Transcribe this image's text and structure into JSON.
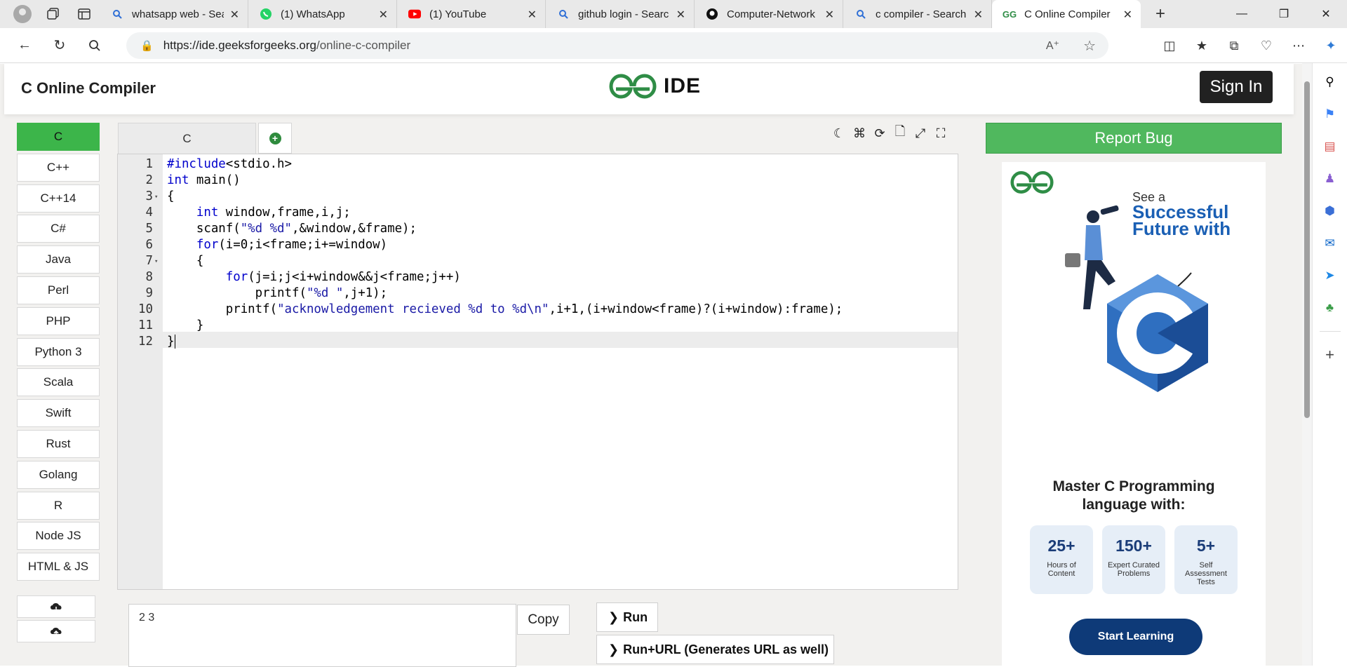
{
  "browser": {
    "tabs": [
      {
        "title": "whatsapp web - Sea",
        "favicon": "search-icon",
        "active": false
      },
      {
        "title": "(1) WhatsApp",
        "favicon": "whatsapp-icon",
        "active": false
      },
      {
        "title": "(1) YouTube",
        "favicon": "youtube-icon",
        "active": false
      },
      {
        "title": "github login - Searc",
        "favicon": "search-icon",
        "active": false
      },
      {
        "title": "Computer-Network",
        "favicon": "github-icon",
        "active": false
      },
      {
        "title": "c compiler - Search",
        "favicon": "search-icon",
        "active": false
      },
      {
        "title": "C Online Compiler",
        "favicon": "gfg-icon",
        "active": true
      }
    ],
    "url": {
      "host": "https://ide.geeksforgeeks.org",
      "path": "/online-c-compiler"
    }
  },
  "header": {
    "title": "C Online Compiler",
    "logo_text": "IDE",
    "signin_label": "Sign In"
  },
  "languages": [
    "C",
    "C++",
    "C++14",
    "C#",
    "Java",
    "Perl",
    "PHP",
    "Python 3",
    "Scala",
    "Swift",
    "Rust",
    "Golang",
    "R",
    "Node JS",
    "HTML & JS"
  ],
  "active_language": "C",
  "editor": {
    "tab_label": "C",
    "line_count": 12,
    "active_line": 12,
    "lines": [
      "#include<stdio.h>",
      "int main()",
      "{",
      "    int window,frame,i,j;",
      "    scanf(\"%d %d\",&window,&frame);",
      "    for(i=0;i<frame;i+=window)",
      "    {",
      "        for(j=i;j<i+window&&j<frame;j++)",
      "            printf(\"%d \",j+1);",
      "        printf(\"acknowledgement recieved %d to %d\\n\",i+1,(i+window<frame)?(i+window):frame);",
      "    }",
      "}"
    ]
  },
  "stdin": {
    "value": "2 3"
  },
  "buttons": {
    "copy": "Copy",
    "run": "Run",
    "run_url": "Run+URL (Generates URL as well)",
    "report_bug": "Report Bug"
  },
  "ad": {
    "see_a": "See a",
    "headline": "Successful Future with",
    "master": "Master C Programming language with:",
    "stats": [
      {
        "big": "25+",
        "small": "Hours of Content"
      },
      {
        "big": "150+",
        "small": "Expert Curated Problems"
      },
      {
        "big": "5+",
        "small": "Self Assessment Tests"
      }
    ],
    "cta": "Start Learning"
  }
}
